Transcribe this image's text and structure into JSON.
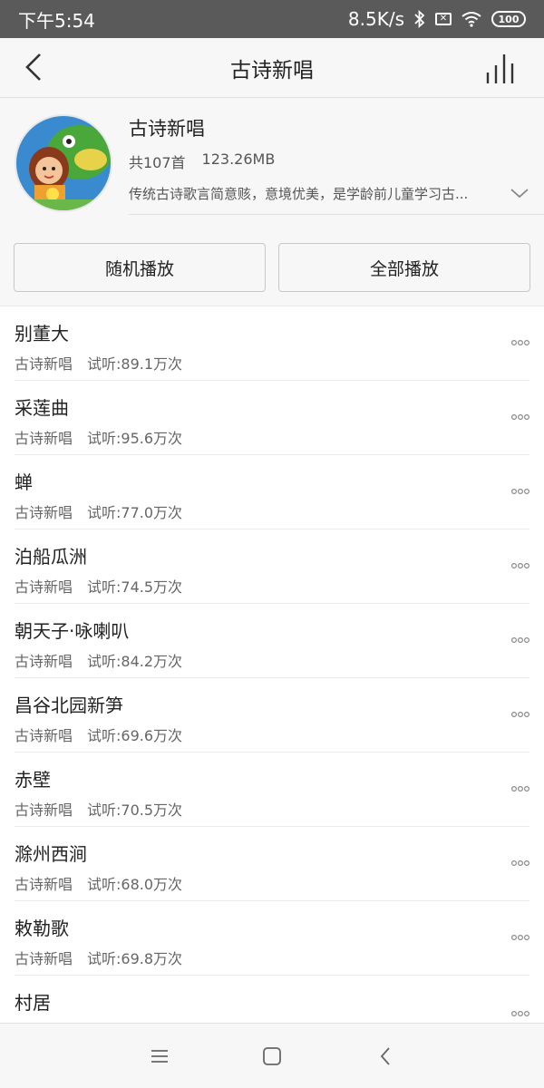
{
  "status": {
    "time": "下午5:54",
    "speed": "8.5K/s",
    "battery": "100"
  },
  "header": {
    "title": "古诗新唱"
  },
  "album": {
    "name": "古诗新唱",
    "count": "共107首",
    "size": "123.26MB",
    "desc": "传统古诗歌言简意赅，意境优美，是学龄前儿童学习古..."
  },
  "buttons": {
    "shuffle": "随机播放",
    "play_all": "全部播放"
  },
  "songs": [
    {
      "title": "别董大",
      "album": "古诗新唱",
      "plays": "试听:89.1万次"
    },
    {
      "title": "采莲曲",
      "album": "古诗新唱",
      "plays": "试听:95.6万次"
    },
    {
      "title": "蝉",
      "album": "古诗新唱",
      "plays": "试听:77.0万次"
    },
    {
      "title": "泊船瓜洲",
      "album": "古诗新唱",
      "plays": "试听:74.5万次"
    },
    {
      "title": "朝天子·咏喇叭",
      "album": "古诗新唱",
      "plays": "试听:84.2万次"
    },
    {
      "title": "昌谷北园新笋",
      "album": "古诗新唱",
      "plays": "试听:69.6万次"
    },
    {
      "title": "赤壁",
      "album": "古诗新唱",
      "plays": "试听:70.5万次"
    },
    {
      "title": "滁州西涧",
      "album": "古诗新唱",
      "plays": "试听:68.0万次"
    },
    {
      "title": "敕勒歌",
      "album": "古诗新唱",
      "plays": "试听:69.8万次"
    },
    {
      "title": "村居",
      "album": "",
      "plays": ""
    }
  ]
}
